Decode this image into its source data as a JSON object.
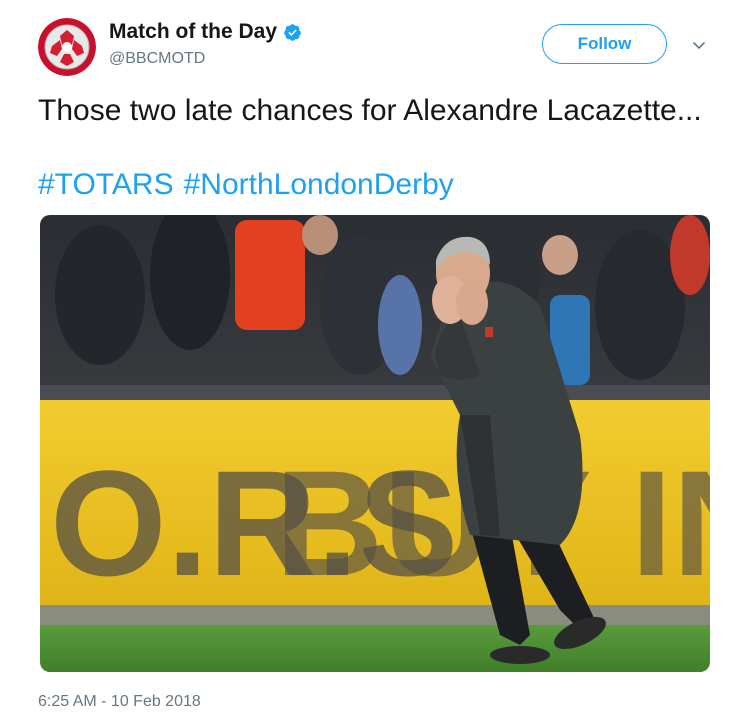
{
  "account": {
    "name": "Match of the Day",
    "handle": "@BBCMOTD",
    "verified": true
  },
  "actions": {
    "follow_label": "Follow"
  },
  "tweet": {
    "text": "Those two late chances for Alexandre Lacazette...",
    "hashtags": [
      "#TOTARS",
      "#NorthLondonDerby"
    ],
    "timestamp": "6:25 AM - 10 Feb 2018"
  },
  "media": {
    "banner_text_left": "O.R.S",
    "banner_text_right": "BUY IN"
  },
  "colors": {
    "accent": "#1da1f2",
    "text_primary": "#14171a",
    "text_secondary": "#657786"
  }
}
